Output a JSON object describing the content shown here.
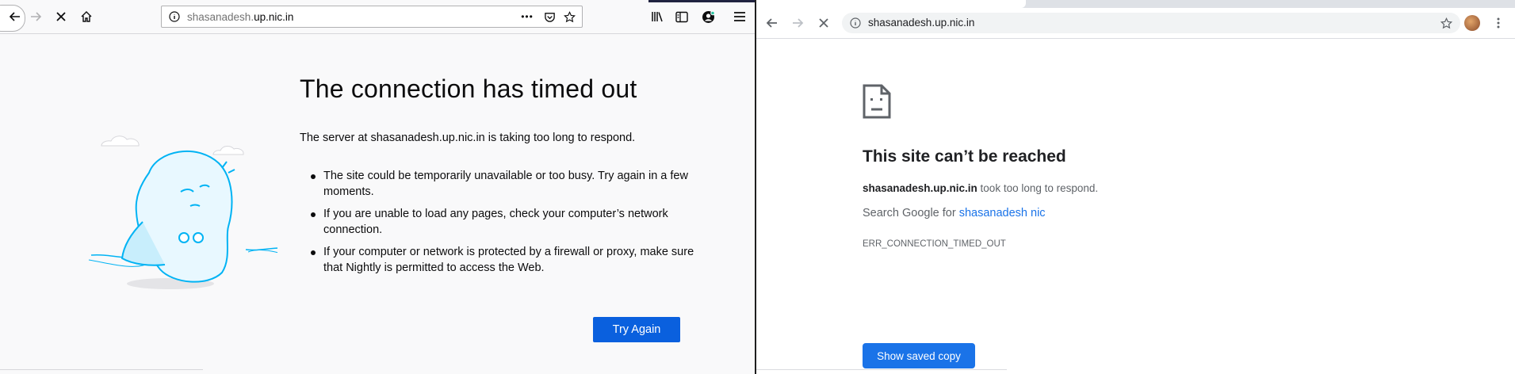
{
  "firefox": {
    "url_host_prefix": "shasanadesh.",
    "url_host_domain": "up.nic.in",
    "page_actions": "•••",
    "error_title": "The connection has timed out",
    "error_desc": "The server at shasanadesh.up.nic.in is taking too long to respond.",
    "suggestions": [
      "The site could be temporarily unavailable or too busy. Try again in a few moments.",
      "If you are unable to load any pages, check your computer’s network connection.",
      "If your computer or network is protected by a firewall or proxy, make sure that Nightly is permitted to access the Web."
    ],
    "try_again": "Try Again",
    "colors": {
      "button": "#0a60de",
      "illustration": "#00b3f4"
    }
  },
  "chrome": {
    "url": "shasanadesh.up.nic.in",
    "heading": "This site can’t be reached",
    "host": "shasanadesh.up.nic.in",
    "host_suffix": " took too long to respond.",
    "search_prefix": "Search Google for ",
    "search_link": "shasanadesh nic",
    "error_code": "ERR_CONNECTION_TIMED_OUT",
    "show_saved_copy": "Show saved copy",
    "colors": {
      "button": "#1a73e8",
      "link": "#1a73e8"
    }
  }
}
